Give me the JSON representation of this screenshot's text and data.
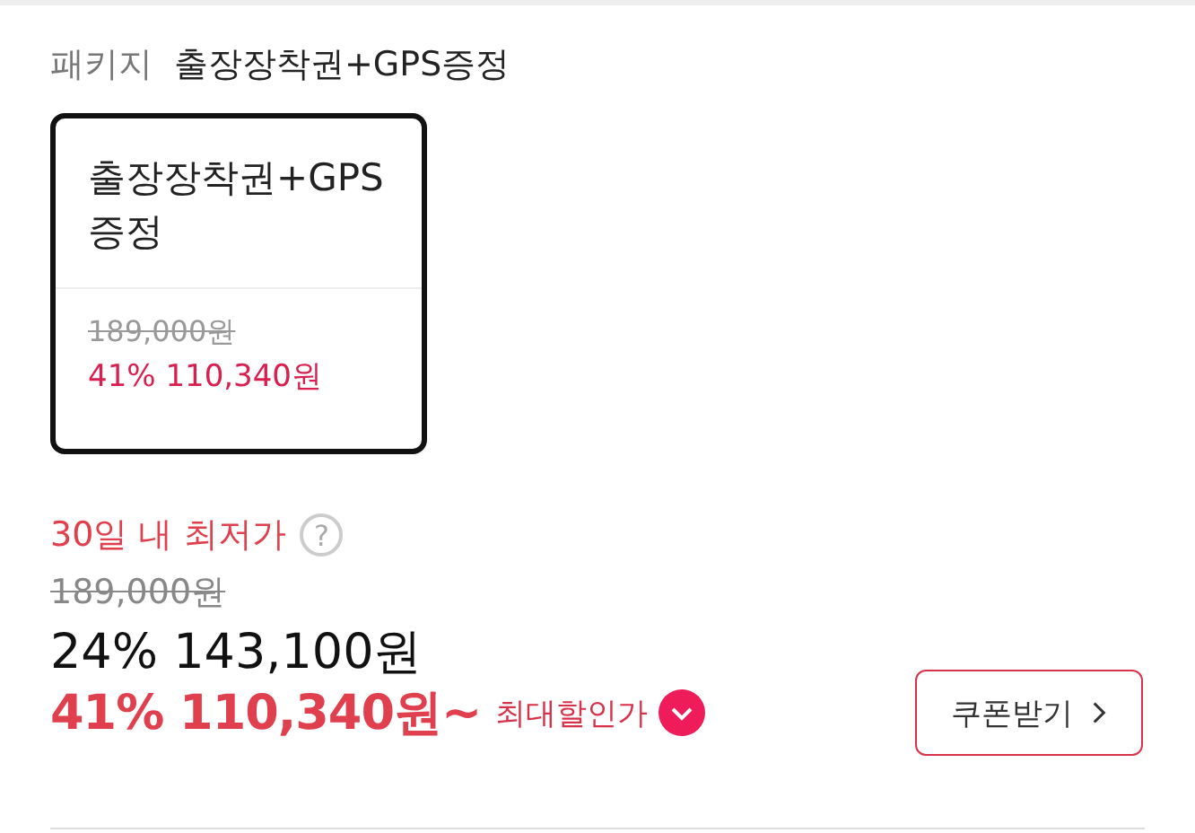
{
  "package": {
    "label": "패키지",
    "value": "출장장착권+GPS증정"
  },
  "options": [
    {
      "title": "출장장착권+GPS증정",
      "original_price": "189,000원",
      "sale_price": "41% 110,340원",
      "selected": true
    }
  ],
  "pricing": {
    "lowest_label": "30일 내 최저가",
    "help_icon": "?",
    "original_price": "189,000원",
    "price": "24% 143,100원",
    "max_discount_price": "41% 110,340원~",
    "max_discount_label": "최대할인가",
    "coupon_button": "쿠폰받기"
  }
}
